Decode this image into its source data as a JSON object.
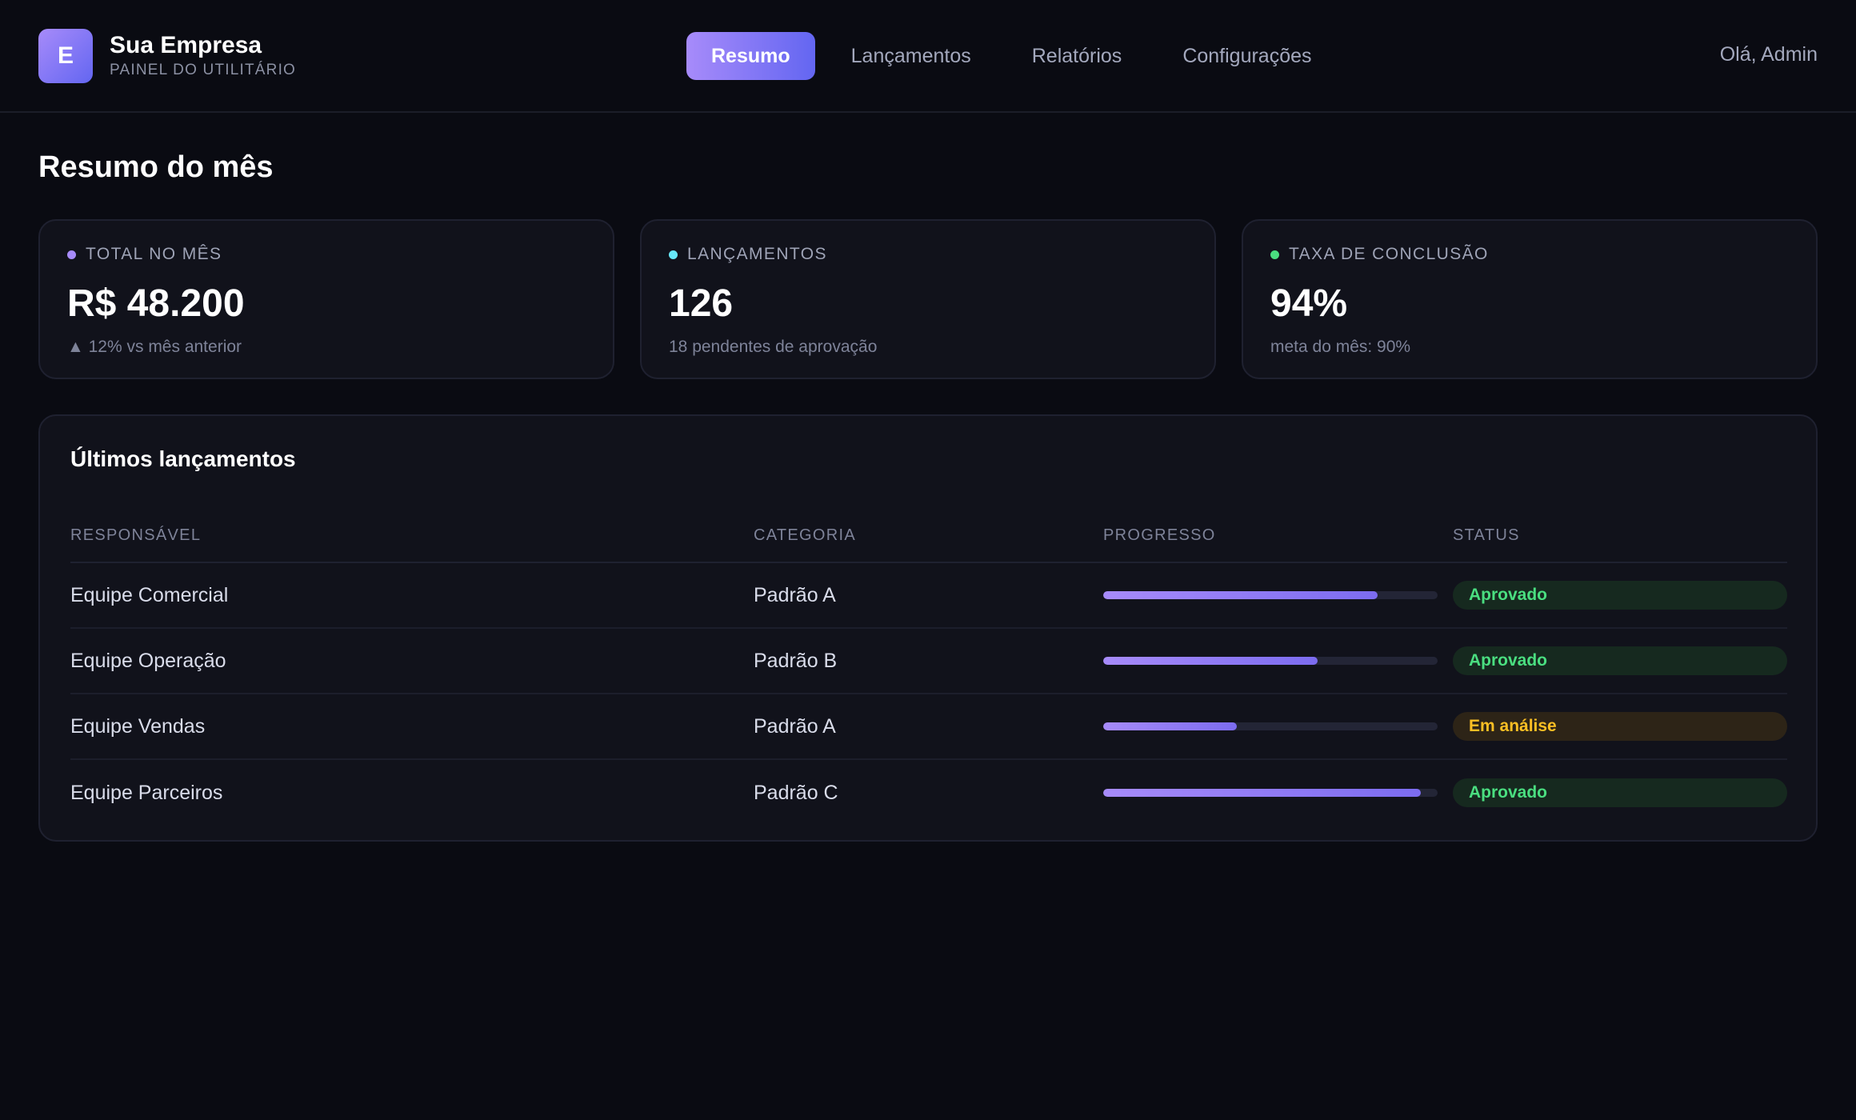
{
  "header": {
    "logo_letter": "E",
    "brand_name": "Sua Empresa",
    "brand_sub": "PAINEL DO UTILITÁRIO",
    "nav": [
      {
        "label": "Resumo",
        "active": true
      },
      {
        "label": "Lançamentos",
        "active": false
      },
      {
        "label": "Relatórios",
        "active": false
      },
      {
        "label": "Configurações",
        "active": false
      }
    ],
    "greeting": "Olá, Admin"
  },
  "main": {
    "title": "Resumo do mês",
    "cards": [
      {
        "label": "TOTAL NO MÊS",
        "value": "R$ 48.200",
        "note": "▲ 12% vs mês anterior",
        "dot_color": "#a78bfa"
      },
      {
        "label": "LANÇAMENTOS",
        "value": "126",
        "note": "18 pendentes de aprovação",
        "dot_color": "#67e8f9"
      },
      {
        "label": "TAXA DE CONCLUSÃO",
        "value": "94%",
        "note": "meta do mês: 90%",
        "dot_color": "#4ade80"
      }
    ],
    "table": {
      "title": "Últimos lançamentos",
      "headers": [
        "RESPONSÁVEL",
        "CATEGORIA",
        "PROGRESSO",
        "STATUS"
      ],
      "rows": [
        {
          "responsavel": "Equipe Comercial",
          "categoria": "Padrão A",
          "progress": 0.82,
          "status": "Aprovado",
          "status_kind": "ok"
        },
        {
          "responsavel": "Equipe Operação",
          "categoria": "Padrão B",
          "progress": 0.64,
          "status": "Aprovado",
          "status_kind": "ok"
        },
        {
          "responsavel": "Equipe Vendas",
          "categoria": "Padrão A",
          "progress": 0.4,
          "status": "Em análise",
          "status_kind": "warn"
        },
        {
          "responsavel": "Equipe Parceiros",
          "categoria": "Padrão C",
          "progress": 0.95,
          "status": "Aprovado",
          "status_kind": "ok"
        }
      ]
    }
  },
  "colors": {
    "accent_start": "#a78bfa",
    "accent_end": "#6366f1",
    "status_ok": "#4ade80",
    "status_warn": "#fbbf24"
  }
}
